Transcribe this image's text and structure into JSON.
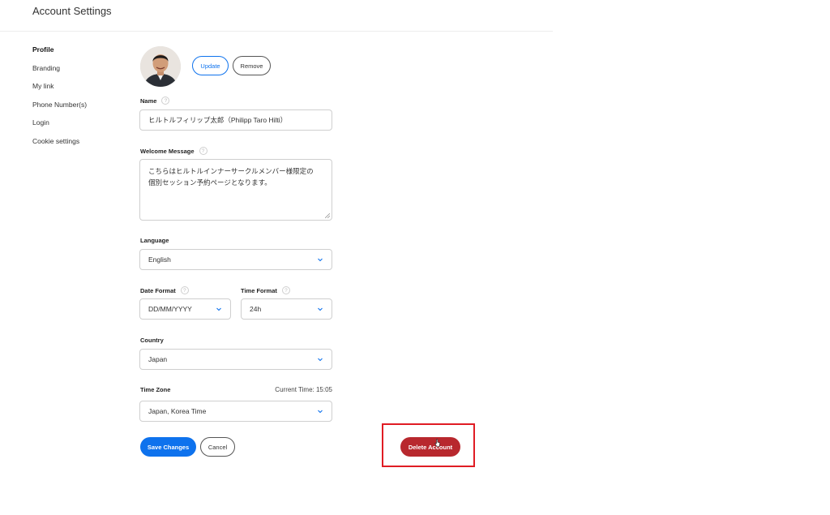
{
  "header": {
    "title": "Account Settings"
  },
  "sidebar": {
    "items": [
      {
        "label": "Profile",
        "active": true
      },
      {
        "label": "Branding"
      },
      {
        "label": "My link"
      },
      {
        "label": "Phone Number(s)"
      },
      {
        "label": "Login"
      },
      {
        "label": "Cookie settings"
      }
    ]
  },
  "profile": {
    "update_label": "Update",
    "remove_label": "Remove",
    "help_glyph": "?",
    "name": {
      "label": "Name",
      "value": "ヒルトルフィリップ太郎（Philipp Taro Hilti）"
    },
    "welcome": {
      "label": "Welcome Message",
      "line1": "こちらはヒルトルインナーサークルメンバー様限定の",
      "line2": "個別セッション予約ページとなります。"
    },
    "language": {
      "label": "Language",
      "value": "English"
    },
    "date_format": {
      "label": "Date Format",
      "value": "DD/MM/YYYY"
    },
    "time_format": {
      "label": "Time Format",
      "value": "24h"
    },
    "country": {
      "label": "Country",
      "value": "Japan"
    },
    "time_zone": {
      "label": "Time Zone",
      "value": "Japan, Korea Time",
      "current_time": "Current Time:  15:05"
    }
  },
  "actions": {
    "save_label": "Save Changes",
    "cancel_label": "Cancel",
    "delete_label": "Delete Account"
  },
  "colors": {
    "primary": "#0e72ed",
    "danger": "#b8282e",
    "highlight": "#e01c24"
  },
  "icons": {
    "help": "help-icon",
    "chevron": "chevron-down-icon",
    "avatar": "avatar",
    "cursor": "hand-cursor-icon"
  }
}
